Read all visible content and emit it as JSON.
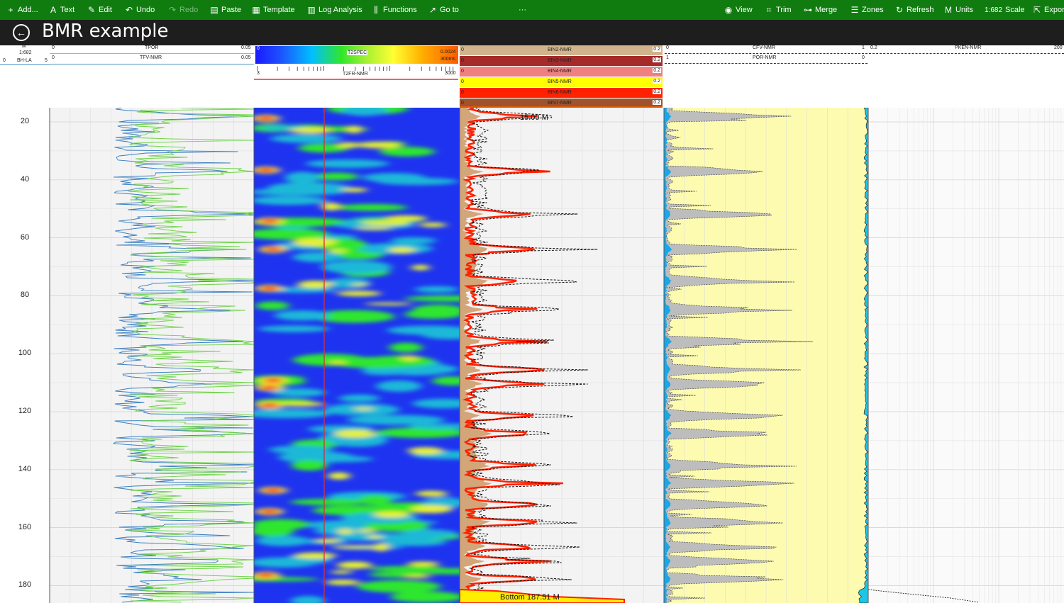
{
  "toolbar": {
    "left": [
      {
        "label": "Add...",
        "icon": "plus-icon",
        "glyph": "+"
      },
      {
        "label": "Text",
        "icon": "text-icon",
        "glyph": "A"
      },
      {
        "label": "Edit",
        "icon": "pencil-icon",
        "glyph": "✎"
      },
      {
        "label": "Undo",
        "icon": "undo-icon",
        "glyph": "↶"
      },
      {
        "label": "Redo",
        "icon": "redo-icon",
        "glyph": "↷",
        "disabled": true
      },
      {
        "label": "Paste",
        "icon": "paste-icon",
        "glyph": "▤"
      },
      {
        "label": "Template",
        "icon": "template-icon",
        "glyph": "▦"
      },
      {
        "label": "Log Analysis",
        "icon": "log-analysis-icon",
        "glyph": "▥"
      },
      {
        "label": "Functions",
        "icon": "functions-icon",
        "glyph": "⫼"
      },
      {
        "label": "Go to",
        "icon": "goto-icon",
        "glyph": "↗"
      }
    ],
    "more": "···",
    "right": [
      {
        "label": "View",
        "icon": "eye-icon",
        "glyph": "◉"
      },
      {
        "label": "Trim",
        "icon": "trim-icon",
        "glyph": "⌗"
      },
      {
        "label": "Merge",
        "icon": "merge-icon",
        "glyph": "⊶"
      },
      {
        "label": "Zones",
        "icon": "zones-icon",
        "glyph": "☰"
      },
      {
        "label": "Refresh",
        "icon": "refresh-icon",
        "glyph": "↻"
      },
      {
        "label": "Units",
        "icon": "units-icon",
        "glyph": "M"
      },
      {
        "label": "Scale",
        "icon": "scale-icon",
        "glyph": "1:682"
      },
      {
        "label": "Expor",
        "icon": "export-icon",
        "glyph": "⇱"
      }
    ]
  },
  "title": "BMR example",
  "header": {
    "depth_unit": "M",
    "scale": "1:682",
    "bh_left": "0",
    "bh_label": "BH-LA",
    "bh_right": "5",
    "tpor": {
      "label": "TPOR",
      "min": "0",
      "max": "0.05",
      "color": "#7ed957"
    },
    "tfv": {
      "label": "TFV-NMR",
      "min": "0",
      "max": "0.05",
      "color": "#4a90c2"
    },
    "t2spec": {
      "label": "T2SPEC",
      "min": "0",
      "max": "0.0024",
      "unit": "300ms"
    },
    "t2fr": {
      "label": "T2FR-NMR",
      "min": "3",
      "max": "3000"
    },
    "bins": [
      {
        "label": "BIN2-NMR",
        "min": "0",
        "max": "0.2",
        "color": "#d2b48c"
      },
      {
        "label": "BIN3-NMR",
        "min": "0",
        "max": "0.2",
        "color": "#a52a2a"
      },
      {
        "label": "BIN4-NMR",
        "min": "0",
        "max": "0.2",
        "color": "#f08080"
      },
      {
        "label": "BIN5-NMR",
        "min": "0",
        "max": "0.2",
        "color": "#ffff00"
      },
      {
        "label": "BIN6-NMR",
        "min": "0",
        "max": "0.2",
        "color": "#ff2200"
      },
      {
        "label": "BIN7-NMR",
        "min": "0",
        "max": "0.2",
        "color": "#a0522d"
      }
    ],
    "cfv": {
      "label": "CFV-NMR",
      "min": "0",
      "max": "1"
    },
    "por": {
      "label": "POR-NMR",
      "min": "1",
      "max": "0"
    },
    "pken": {
      "label": "PKEN-NMR",
      "min": "0.2",
      "max": "200"
    }
  },
  "depth_ticks": [
    "20",
    "40",
    "60",
    "80",
    "100",
    "120",
    "140",
    "160",
    "180"
  ],
  "annotations": {
    "top": "15.00 M",
    "bottom": "Bottom 187.51 M"
  }
}
